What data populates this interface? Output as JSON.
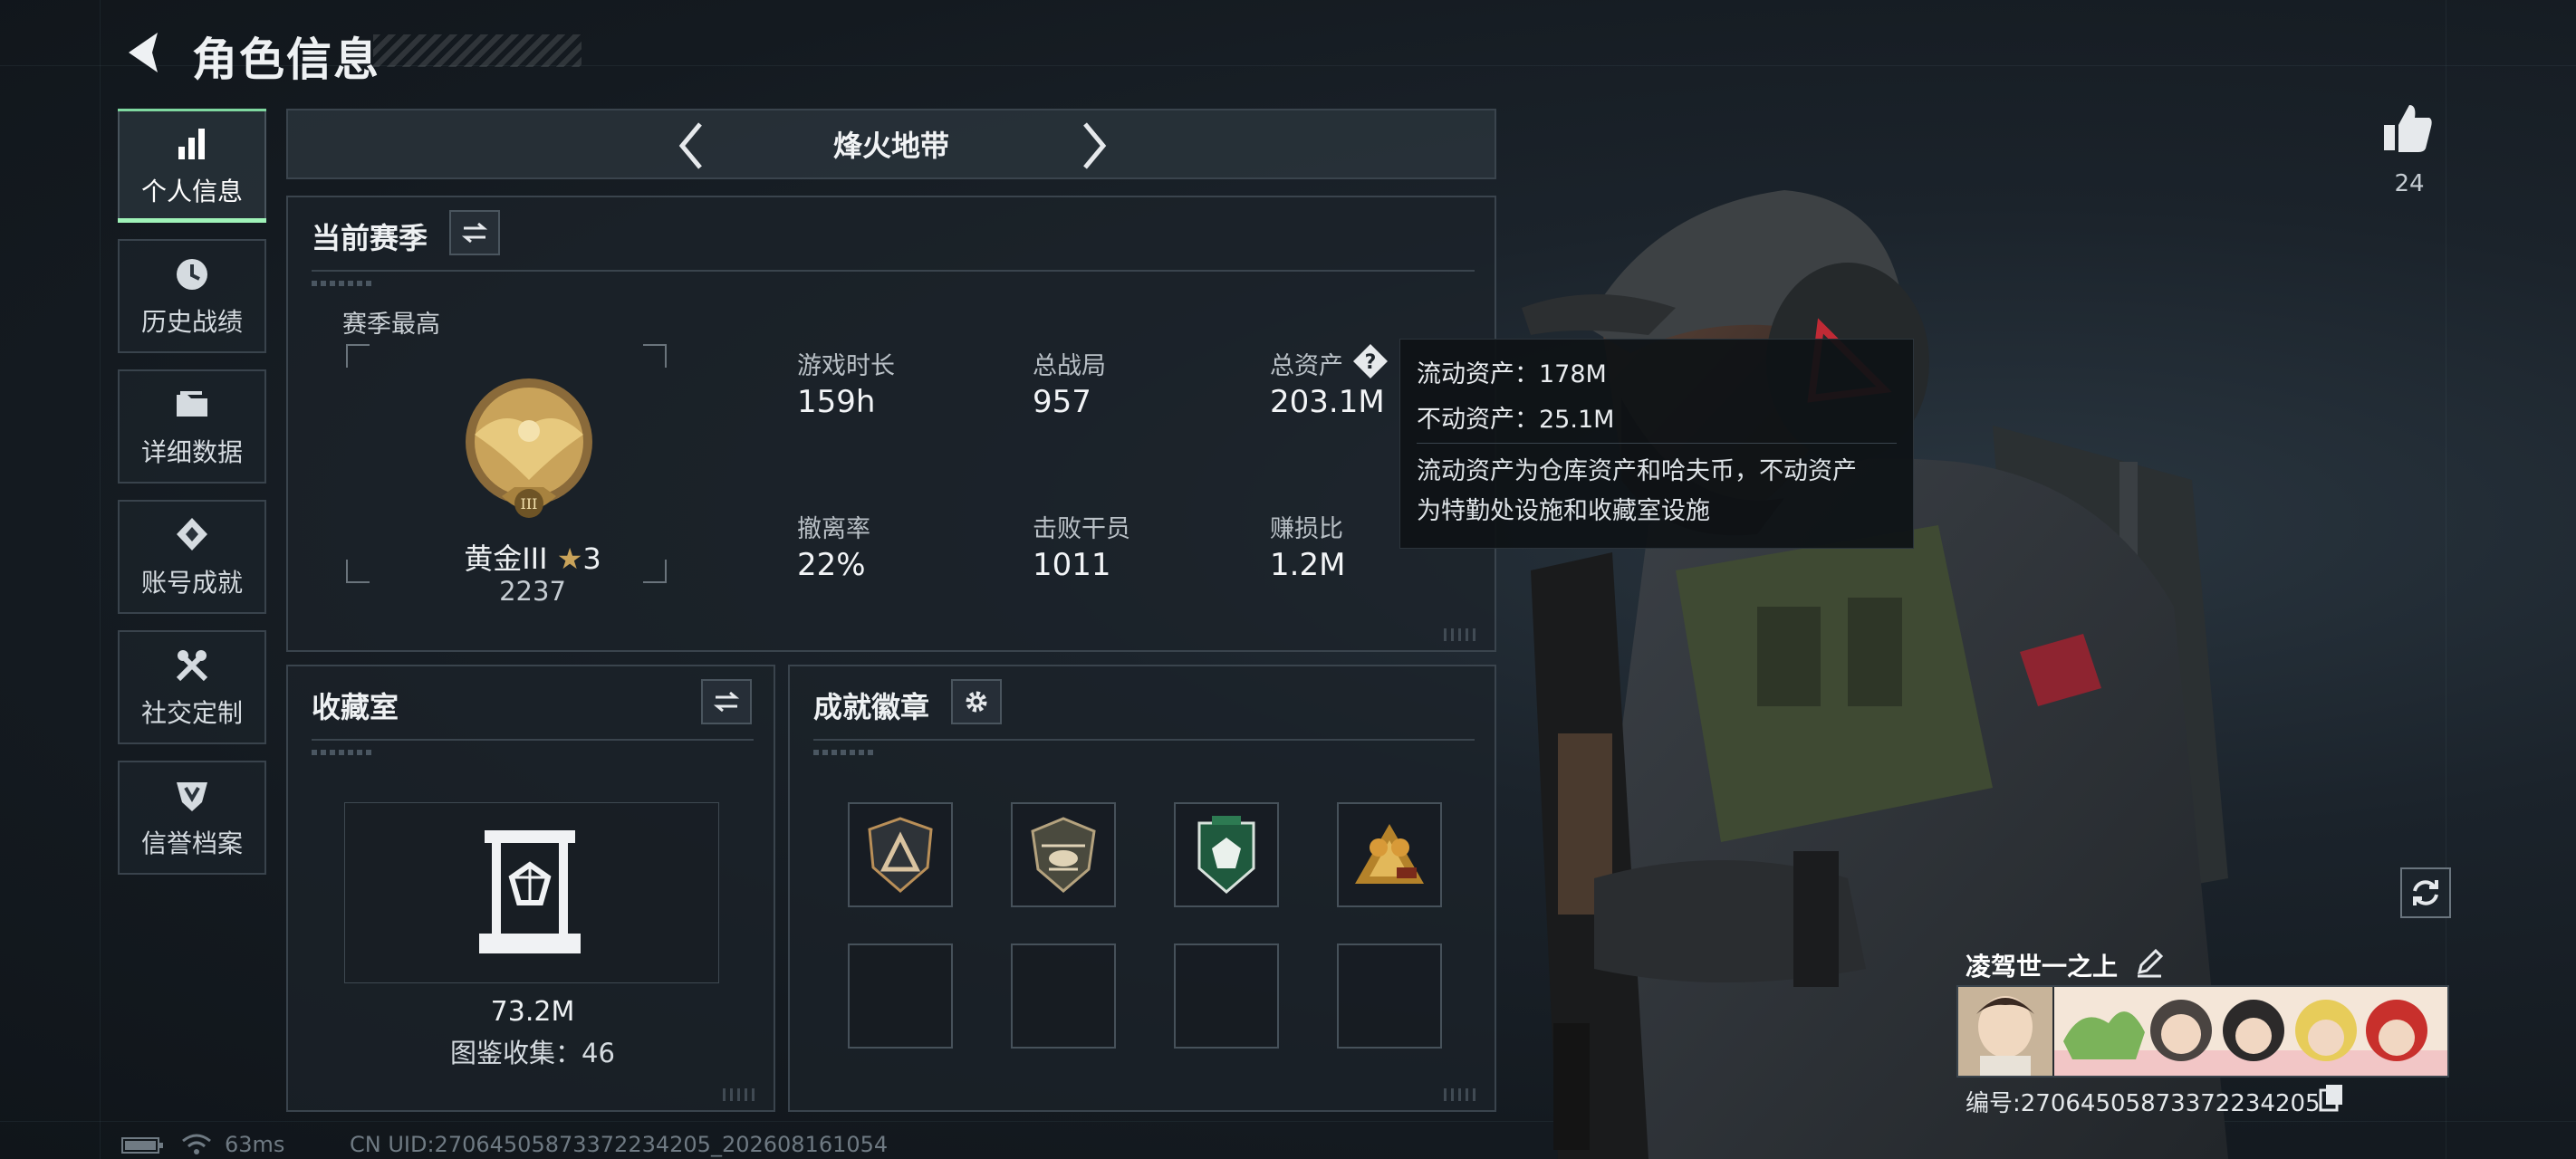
{
  "header": {
    "title": "角色信息"
  },
  "nav": [
    {
      "label": "个人信息",
      "icon": "bar-chart-icon",
      "active": true
    },
    {
      "label": "历史战绩",
      "icon": "clock-icon",
      "active": false
    },
    {
      "label": "详细数据",
      "icon": "folder-icon",
      "active": false
    },
    {
      "label": "账号成就",
      "icon": "achievement-icon",
      "active": false
    },
    {
      "label": "社交定制",
      "icon": "tools-icon",
      "active": false
    },
    {
      "label": "信誉档案",
      "icon": "shield-icon",
      "active": false
    }
  ],
  "mode": {
    "name": "烽火地带"
  },
  "season": {
    "title": "当前赛季",
    "best_label": "赛季最高",
    "rank_name": "黄金III",
    "rank_stars": "3",
    "rank_points": "2237",
    "stats": [
      {
        "label": "游戏时长",
        "value": "159h"
      },
      {
        "label": "总战局",
        "value": "957"
      },
      {
        "label": "总资产",
        "value": "203.1M"
      },
      {
        "label": "撤离率",
        "value": "22%"
      },
      {
        "label": "击败干员",
        "value": "1011"
      },
      {
        "label": "赚损比",
        "value": "1.2M"
      }
    ]
  },
  "tooltip": {
    "liquid": "流动资产：178M",
    "fixed": "不动资产：25.1M",
    "desc_line1": "流动资产为仓库资产和哈夫币，不动资产",
    "desc_line2": "为特勤处设施和收藏室设施"
  },
  "collection": {
    "title": "收藏室",
    "value": "73.2M",
    "catalog": "图鉴收集：46"
  },
  "badges": {
    "title": "成就徽章",
    "slots": [
      "triangle-badge-icon",
      "helicopter-badge-icon",
      "gem-shield-badge-icon",
      "gold-emblem-badge-icon",
      "",
      "",
      "",
      ""
    ]
  },
  "player": {
    "likes": "24",
    "name": "凌驾世一之上",
    "id": "编号:270645058733722342​05"
  },
  "status": {
    "ping": "63ms",
    "uid": "CN UID:2706450587337223420​5_202608161054"
  },
  "colors": {
    "accent": "#9ff2b8",
    "rank_gold": "#c9a35a",
    "panel_border": "#3a444d"
  }
}
